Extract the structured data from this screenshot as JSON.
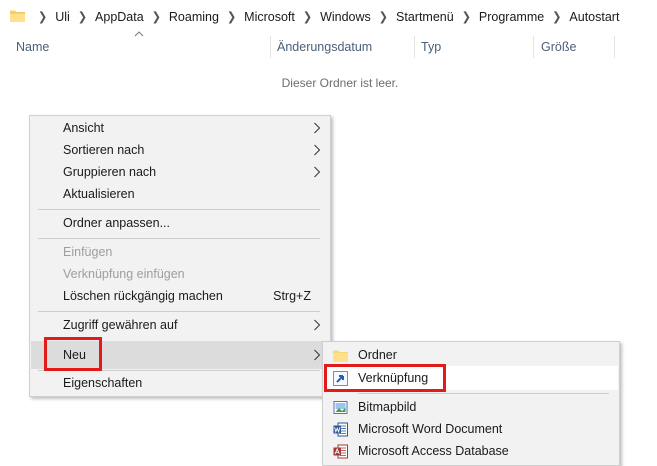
{
  "address_bar": {
    "breadcrumbs": [
      "Uli",
      "AppData",
      "Roaming",
      "Microsoft",
      "Windows",
      "Startmenü",
      "Programme",
      "Autostart"
    ]
  },
  "columns": {
    "name": "Name",
    "date": "Änderungsdatum",
    "type": "Typ",
    "size": "Größe"
  },
  "empty_message": "Dieser Ordner ist leer.",
  "context_menu": {
    "view": "Ansicht",
    "sort_by": "Sortieren nach",
    "group_by": "Gruppieren nach",
    "refresh": "Aktualisieren",
    "customize_folder": "Ordner anpassen...",
    "paste": "Einfügen",
    "paste_shortcut": "Verknüpfung einfügen",
    "undo_delete": "Löschen rückgängig machen",
    "undo_delete_shortcut": "Strg+Z",
    "give_access": "Zugriff gewähren auf",
    "new": "Neu",
    "properties": "Eigenschaften"
  },
  "submenu_new": {
    "folder": "Ordner",
    "shortcut": "Verknüpfung",
    "bitmap": "Bitmapbild",
    "word": "Microsoft Word Document",
    "access": "Microsoft Access Database"
  },
  "colors": {
    "highlight_box": "#e21a1a",
    "menu_background": "#f2f2f2",
    "column_header_text": "#4c607a"
  }
}
